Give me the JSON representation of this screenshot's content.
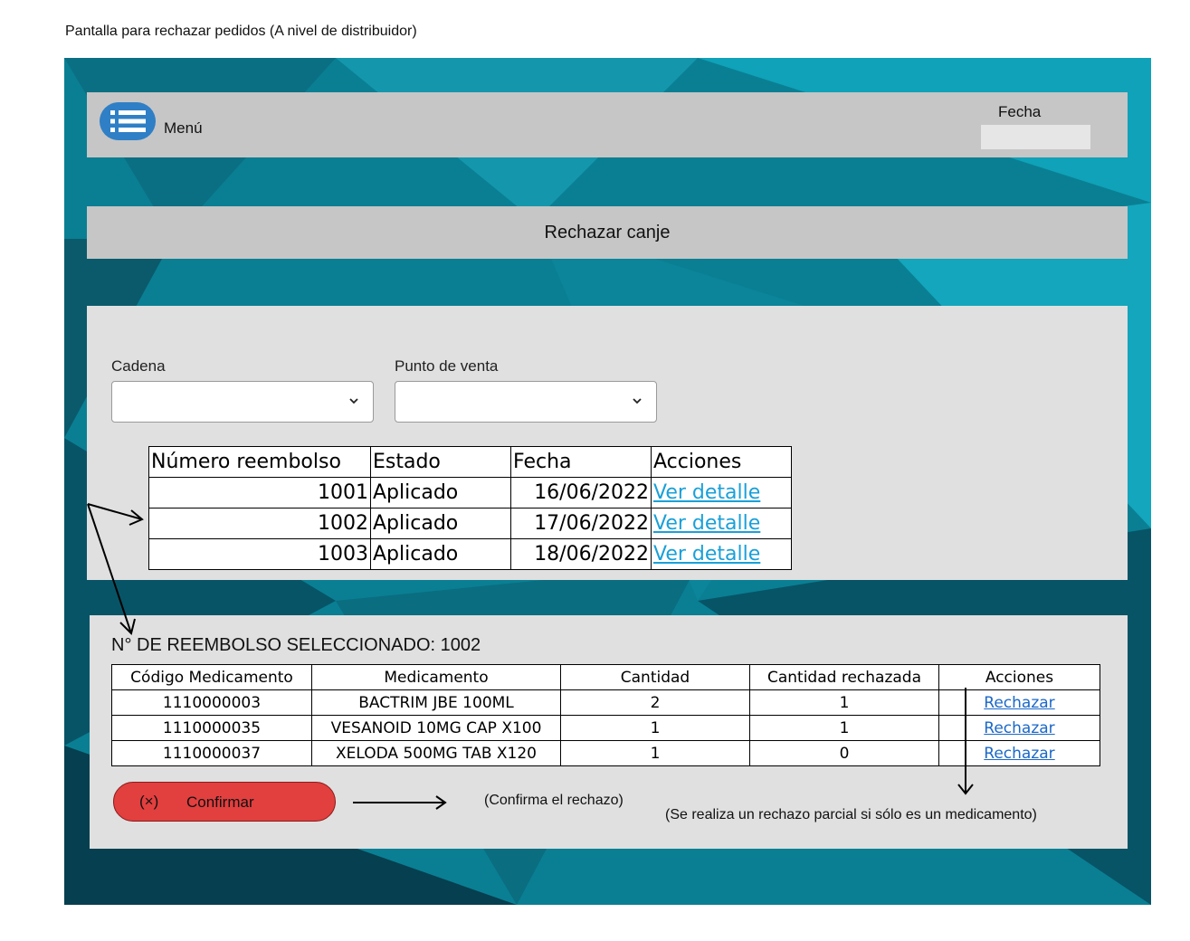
{
  "caption": "Pantalla para rechazar pedidos (A nivel de distribuidor)",
  "colors": {
    "background": "#0a7f93",
    "bars": "#c6c6c6",
    "panels": "#e0e0e0",
    "menu_icon": "#2f7fc6",
    "confirm_button": "#e23f3f",
    "link_primary": "#1aa0d8",
    "link_secondary": "#1a68c8"
  },
  "header": {
    "menu_icon": "list-icon",
    "menu_label": "Menú",
    "date_label": "Fecha",
    "date_value": ""
  },
  "title": "Rechazar canje",
  "filters": {
    "cadena_label": "Cadena",
    "cadena_value": "",
    "punto_label": "Punto de venta",
    "punto_value": ""
  },
  "reembolsos": {
    "headers": [
      "Número reembolso",
      "Estado",
      "Fecha",
      "Acciones"
    ],
    "rows": [
      {
        "numero": "1001",
        "estado": "Aplicado",
        "fecha": "16/06/2022",
        "accion": "Ver detalle"
      },
      {
        "numero": "1002",
        "estado": "Aplicado",
        "fecha": "17/06/2022",
        "accion": "Ver detalle"
      },
      {
        "numero": "1003",
        "estado": "Aplicado",
        "fecha": "18/06/2022",
        "accion": "Ver detalle"
      }
    ]
  },
  "selected": {
    "title": "N° DE REEMBOLSO SELECCIONADO: 1002",
    "headers": [
      "Código Medicamento",
      "Medicamento",
      "Cantidad",
      "Cantidad rechazada",
      "Acciones"
    ],
    "rows": [
      {
        "codigo": "1110000003",
        "medicamento": "BACTRIM JBE 100ML",
        "cantidad": "2",
        "rechazada": "1",
        "accion": "Rechazar"
      },
      {
        "codigo": "1110000035",
        "medicamento": "VESANOID 10MG CAP X100",
        "cantidad": "1",
        "rechazada": "1",
        "accion": "Rechazar"
      },
      {
        "codigo": "1110000037",
        "medicamento": "XELODA 500MG TAB X120",
        "cantidad": "1",
        "rechazada": "0",
        "accion": "Rechazar"
      }
    ]
  },
  "confirm": {
    "icon": "x-circle-icon",
    "icon_glyph": "(×)",
    "label": "Confirmar"
  },
  "notes": {
    "confirm_note": "(Confirma el rechazo)",
    "partial_note": "(Se realiza un rechazo parcial si sólo es un medicamento)"
  }
}
